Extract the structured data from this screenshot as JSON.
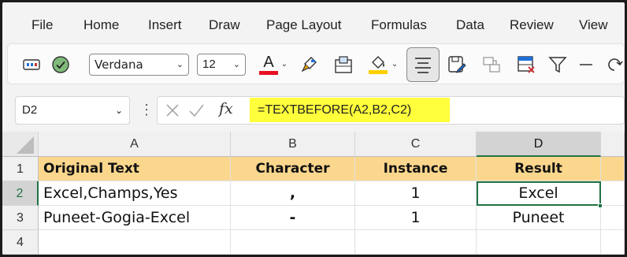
{
  "menu": [
    "File",
    "Home",
    "Insert",
    "Draw",
    "Page Layout",
    "Formulas",
    "Data",
    "Review",
    "View"
  ],
  "ribbon": {
    "font_name": "Verdana",
    "font_size": "12",
    "font_color_letter": "A",
    "font_color": "#e81123",
    "fill_color": "#ffd000"
  },
  "formula_bar": {
    "name_box": "D2",
    "fx": "fx",
    "formula": "=TEXTBEFORE(A2,B2,C2)"
  },
  "columns": [
    "A",
    "B",
    "C",
    "D"
  ],
  "rows": [
    "1",
    "2",
    "3",
    "4"
  ],
  "cells": {
    "header": [
      "Original Text",
      "Character",
      "Instance",
      "Result"
    ],
    "r2": [
      "Excel,Champs,Yes",
      ",",
      "1",
      "Excel"
    ],
    "r3": [
      "Puneet-Gogia-Excel",
      "-",
      "1",
      "Puneet"
    ]
  },
  "colors": {
    "header_fill": "#fbd78e",
    "formula_highlight": "#ffff3c",
    "selection": "#217346"
  }
}
